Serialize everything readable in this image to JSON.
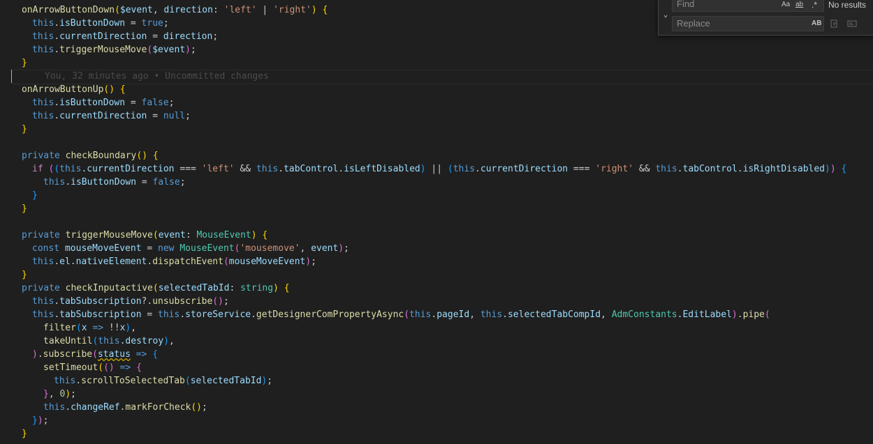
{
  "blame": {
    "text": "You, 32 minutes ago • Uncommitted changes"
  },
  "find": {
    "find_placeholder": "Find",
    "replace_placeholder": "Replace",
    "match_case": "Aa",
    "whole_word": "ab",
    "regex": ".*",
    "preserve_case": "AB",
    "status": "No results",
    "toggle_replace": "⌄"
  },
  "code": [
    "onArrowButtonDown($event, direction: 'left' | 'right') {",
    "this.isButtonDown = true;",
    "this.currentDirection = direction;",
    "this.triggerMouseMove($event);",
    "}",
    "onArrowButtonUp() {",
    "this.isButtonDown = false;",
    "this.currentDirection = null;",
    "}",
    "private checkBoundary() {",
    "if ((this.currentDirection === 'left' && this.tabControl.isLeftDisabled) || (this.currentDirection === 'right' && this.tabControl.isRightDisabled)) {",
    "this.isButtonDown = false;",
    "}",
    "}",
    "private triggerMouseMove(event: MouseEvent) {",
    "const mouseMoveEvent = new MouseEvent('mousemove', event);",
    "this.el.nativeElement.dispatchEvent(mouseMoveEvent);",
    "}",
    "private checkInputactive(selectedTabId: string) {",
    "this.tabSubscription?.unsubscribe();",
    "this.tabSubscription = this.storeService.getDesignerComPropertyAsync(this.pageId, this.selectedTabCompId, AdmConstants.EditLabel).pipe(",
    "filter(x => !!x),",
    "takeUntil(this.destroy),",
    ").subscribe(status => {",
    "setTimeout(() => {",
    "this.scrollToSelectedTab(selectedTabId);",
    "}, 0);",
    "this.changeRef.markForCheck();",
    "});",
    "}"
  ]
}
